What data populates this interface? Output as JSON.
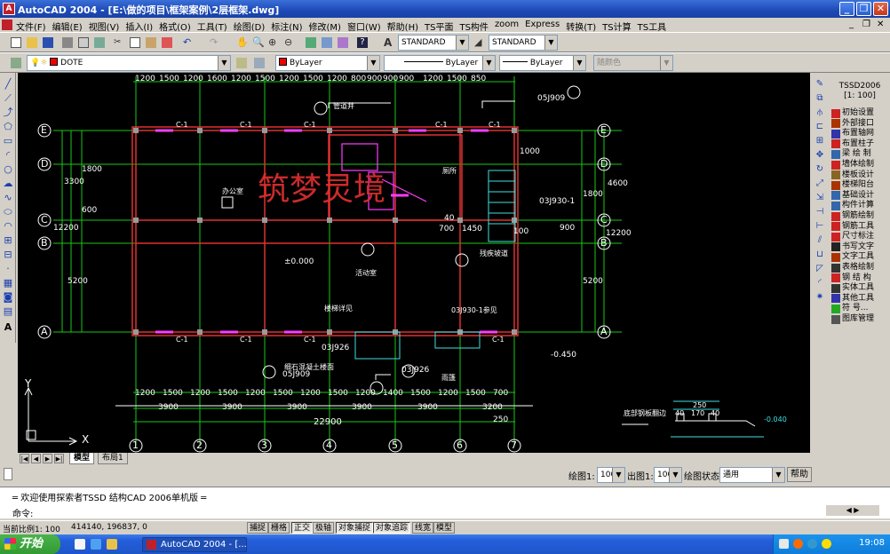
{
  "window": {
    "title": "AutoCAD 2004 - [E:\\做的项目\\框架案例\\2层框架.dwg]",
    "app_icon": "A"
  },
  "menu": [
    "文件(F)",
    "编辑(E)",
    "视图(V)",
    "插入(I)",
    "格式(O)",
    "工具(T)",
    "绘图(D)",
    "标注(N)",
    "修改(M)",
    "窗口(W)",
    "帮助(H)",
    "TS平面",
    "TS构件",
    "zoom",
    "Express",
    "转换(T)",
    "TS计算",
    "TS工具"
  ],
  "toolbar": {
    "text_style": "STANDARD",
    "dim_style": "STANDARD",
    "layer": "DOTE",
    "color": "ByLayer",
    "linetype": "ByLayer",
    "lineweight": "ByLayer",
    "plot_style": "随颜色"
  },
  "drawing": {
    "top_dims": [
      "1200",
      "1500",
      "1200",
      "1600",
      "1200",
      "1500",
      "1200",
      "1500",
      "1200",
      "800",
      "900",
      "900",
      "900",
      "1200",
      "1500",
      "850"
    ],
    "bottom_dims_1": [
      "1200",
      "1500",
      "1200",
      "1500",
      "1200",
      "1500",
      "1200",
      "1500",
      "1200",
      "1400",
      "1500",
      "1200",
      "1500",
      "700"
    ],
    "bottom_dims_2": [
      "3900",
      "3900",
      "3900",
      "3900",
      "3900",
      "3200"
    ],
    "total_width": "22900",
    "col_axes": [
      "1",
      "2",
      "3",
      "4",
      "5",
      "6",
      "7"
    ],
    "row_axes": [
      "E",
      "D",
      "C",
      "B",
      "A"
    ],
    "left_dims": [
      "3300",
      "1800",
      "600",
      "12200",
      "5200"
    ],
    "right_dims": [
      "4600",
      "1800",
      "900",
      "12200",
      "5200"
    ],
    "labels": {
      "wall_label": "C-1",
      "room_office": "办公室",
      "room_activity": "活动室",
      "elevation_0": "±0.000",
      "elevation_neg": "-0.450",
      "elevation_neg2": "-0.040",
      "stair_ref": "03J930-1",
      "ref_03j926": "03J926",
      "ref_05j909": "05J909",
      "ref_03j930_b": "03J930-1参见",
      "note_ramp": "残疾坡道",
      "note_stair": "楼梯详见",
      "note_toilet": "厕所",
      "note_floor": "细石混凝土楼面",
      "note_duct": "管道井",
      "note_porch": "雨篷",
      "note_cutout": "底部钢板翻边",
      "detail_dims": [
        "250",
        "40",
        "170",
        "40"
      ],
      "dims_small": [
        "1000",
        "1450",
        "100",
        "700",
        "250",
        "40",
        "600"
      ],
      "watermark": "筑梦灵境",
      "ucs_y": "Y",
      "ucs_x": "X"
    }
  },
  "tabs": {
    "model": "模型",
    "layout1": "布局1"
  },
  "scale_row": {
    "draw_label": "绘图1:",
    "draw_value": "100",
    "out_label": "出图1:",
    "out_value": "100",
    "state_label": "绘图状态",
    "state_value": "通用",
    "help": "帮助"
  },
  "command": {
    "welcome": "欢迎使用探索者TSSD 结构CAD 2006单机版",
    "prompt": "命令:"
  },
  "status": {
    "scale": "当前比例1: 100",
    "coords": "414140, 196837, 0",
    "buttons": [
      "捕捉",
      "栅格",
      "正交",
      "极轴",
      "对象捕捉",
      "对象追踪",
      "线宽",
      "模型"
    ]
  },
  "tssd_panel": {
    "title": "TSSD2006",
    "scale": "[1: 100]",
    "items": [
      "初始设置",
      "外部接口",
      "布置轴网",
      "布置柱子",
      "梁 绘 制",
      "墙体绘制",
      "楼板设计",
      "楼梯阳台",
      "基础设计",
      "构件计算",
      "钢筋绘制",
      "钢筋工具",
      "尺寸标注",
      "书写文字",
      "文字工具",
      "表格绘制",
      "钢 结 构",
      "实体工具",
      "其他工具",
      "符 号...",
      "图库管理"
    ]
  },
  "taskbar": {
    "start": "开始",
    "task": "AutoCAD 2004 - [...",
    "time": "19:08"
  }
}
